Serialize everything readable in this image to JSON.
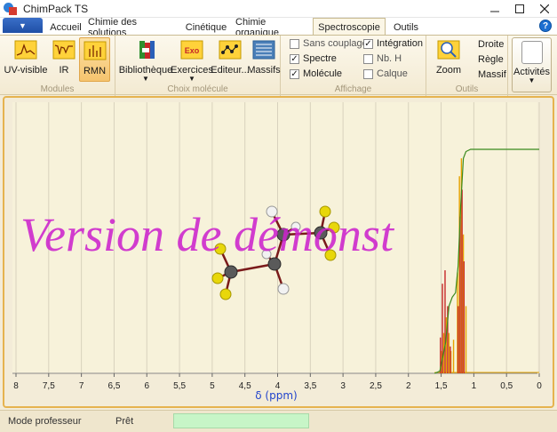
{
  "window": {
    "title": "ChimPack TS",
    "minimize_icon": "minimize-icon",
    "maximize_icon": "maximize-icon",
    "close_icon": "close-icon"
  },
  "tabs": [
    {
      "label": "Accueil",
      "active": false
    },
    {
      "label": "Chimie des solutions",
      "active": false
    },
    {
      "label": "Cinétique",
      "active": false
    },
    {
      "label": "Chimie organique",
      "active": false
    },
    {
      "label": "Spectroscopie",
      "active": true
    },
    {
      "label": "Outils",
      "active": false
    }
  ],
  "ribbon": {
    "modules": {
      "label": "Modules",
      "buttons": [
        {
          "label": "UV-visible",
          "icon": "uv-spectrum-icon",
          "selected": false
        },
        {
          "label": "IR",
          "icon": "ir-spectrum-icon",
          "selected": false
        },
        {
          "label": "RMN",
          "icon": "nmr-spectrum-icon",
          "selected": true
        }
      ]
    },
    "choix": {
      "label": "Choix molécule",
      "buttons": [
        {
          "label": "Bibliothèque",
          "icon": "library-icon",
          "dropdown": true
        },
        {
          "label": "Exercices",
          "icon": "exercises-icon",
          "dropdown": true
        },
        {
          "label": "Editeur...",
          "icon": "editor-icon",
          "dropdown": false
        },
        {
          "label": "Massifs",
          "icon": "multiplets-icon",
          "dropdown": false
        }
      ]
    },
    "affichage": {
      "label": "Affichage",
      "checkboxes": [
        {
          "label": "Sans couplage",
          "checked": false
        },
        {
          "label": "Spectre",
          "checked": true
        },
        {
          "label": "Molécule",
          "checked": true
        },
        {
          "label": "Intégration",
          "checked": true
        },
        {
          "label": "Nb. H",
          "checked": false
        },
        {
          "label": "Calque",
          "checked": false
        }
      ]
    },
    "outils": {
      "label": "Outils",
      "zoom_label": "Zoom",
      "zoom_icon": "zoom-icon",
      "droite_label": "Droite",
      "regle_label": "Règle",
      "massif_label": "Massif"
    },
    "activites": {
      "label": "Activités"
    }
  },
  "chart_data": {
    "type": "line",
    "xlabel": "δ (ppm)",
    "xlim": [
      8,
      0
    ],
    "x_ticks": [
      "8",
      "7,5",
      "7",
      "6,5",
      "6",
      "5,5",
      "5",
      "4,5",
      "4",
      "3,5",
      "3",
      "2,5",
      "2",
      "1,5",
      "1",
      "0,5",
      "0"
    ],
    "grid": true,
    "watermark": "Version de démonst",
    "series": [
      {
        "kind": "peaks",
        "color": "#e5a300",
        "x": [
          1.49,
          1.46,
          1.42,
          1.38,
          1.35,
          1.31,
          1.25,
          1.22,
          1.19,
          1.16,
          1.12
        ],
        "y": [
          0.1,
          0.18,
          0.25,
          0.18,
          0.1,
          0.15,
          0.45,
          0.88,
          0.96,
          0.62,
          0.3
        ]
      },
      {
        "kind": "peaks",
        "color": "#c62828",
        "x": [
          1.51,
          1.48,
          1.44,
          1.4,
          1.36,
          1.24,
          1.21,
          1.18,
          1.15
        ],
        "y": [
          0.16,
          0.4,
          0.46,
          0.3,
          0.12,
          0.3,
          0.7,
          0.82,
          0.5
        ]
      },
      {
        "kind": "integration",
        "color": "#3a8a1e",
        "x": [
          1.6,
          1.52,
          1.47,
          1.43,
          1.38,
          1.33,
          1.28,
          1.24,
          1.2,
          1.16,
          1.12,
          1.05,
          0.0
        ],
        "y": [
          0.0,
          0.01,
          0.08,
          0.14,
          0.3,
          0.34,
          0.36,
          0.48,
          0.75,
          0.96,
          0.99,
          1.0,
          1.0
        ]
      }
    ]
  },
  "status": {
    "mode": "Mode professeur",
    "state": "Prêt"
  }
}
